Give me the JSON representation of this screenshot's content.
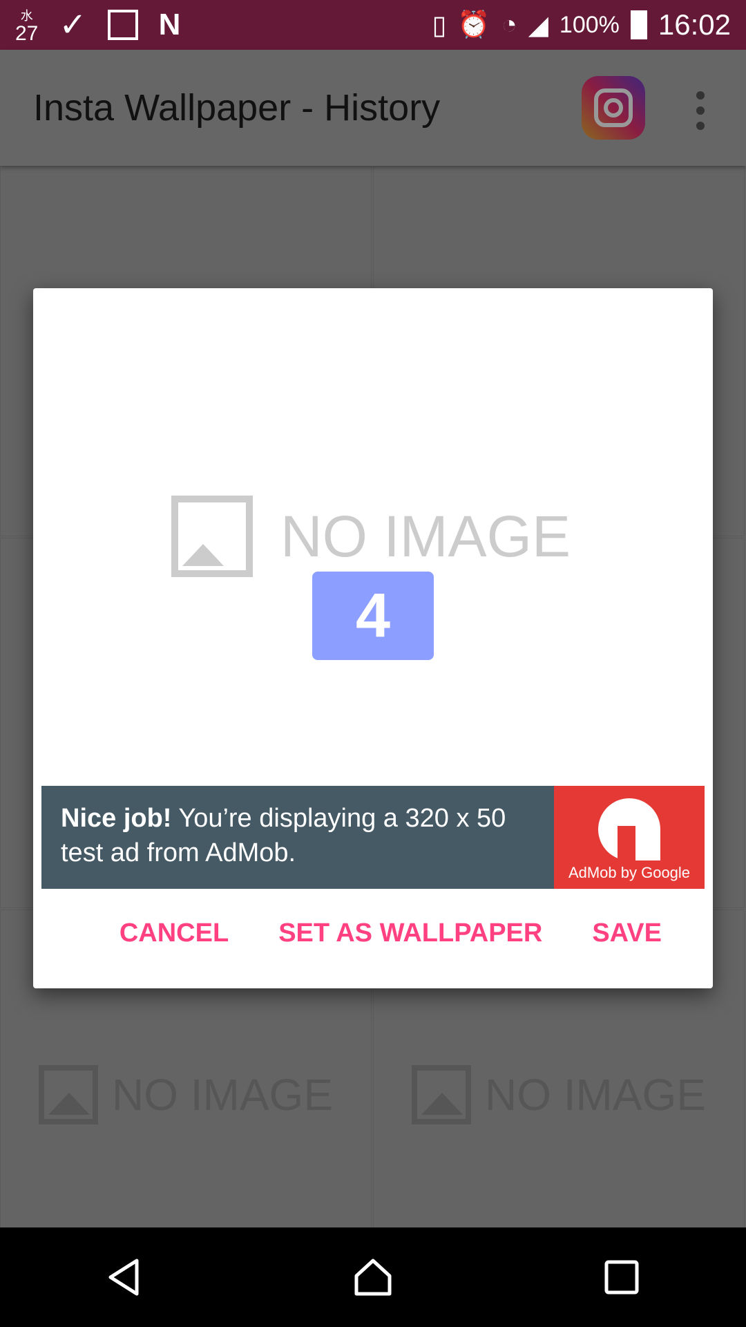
{
  "status_bar": {
    "date": "27",
    "date_kanji": "水",
    "battery": "100%",
    "time": "16:02"
  },
  "app_bar": {
    "title": "Insta Wallpaper - History"
  },
  "grid": {
    "placeholder": "NO IMAGE"
  },
  "dialog": {
    "placeholder": "NO IMAGE",
    "index_badge": "4",
    "ad": {
      "bold": "Nice job!",
      "text": " You’re displaying a 320 x 50 test ad from AdMob.",
      "brand": "AdMob by Google"
    },
    "actions": {
      "cancel": "CANCEL",
      "set_wallpaper": "SET AS WALLPAPER",
      "save": "SAVE"
    }
  },
  "colors": {
    "status_bar": "#641a36",
    "accent": "#ff4081",
    "badge": "#8c9eff",
    "ad_bg": "#455a64",
    "ad_logo": "#e53935"
  }
}
